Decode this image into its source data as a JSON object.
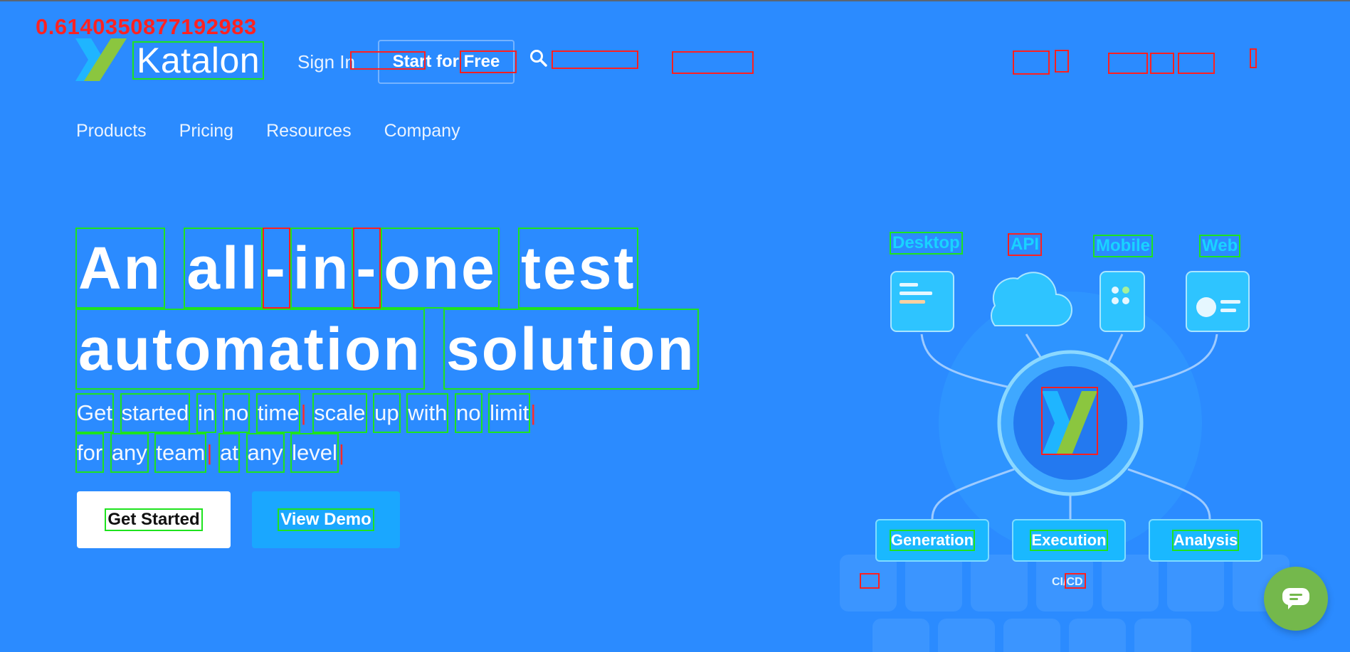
{
  "overlay": {
    "score": "0.6140350877192983"
  },
  "header": {
    "brand": "Katalon",
    "sign_in": "Sign In",
    "start_for_free": "Start for Free"
  },
  "nav": {
    "items": [
      "Products",
      "Pricing",
      "Resources",
      "Company"
    ]
  },
  "hero": {
    "title_line1": [
      "An",
      "all",
      "-",
      "in",
      "-",
      "one",
      "test"
    ],
    "title_line2": [
      "automation",
      "solution"
    ],
    "sub_line1": [
      "Get",
      "started",
      "in",
      "no",
      "time",
      "scale",
      "up",
      "with",
      "no",
      "limit"
    ],
    "sub_line2": [
      "for",
      "any",
      "team",
      "at",
      "any",
      "level"
    ],
    "get_started": "Get Started",
    "view_demo": "View Demo"
  },
  "diagram": {
    "platforms": [
      "Desktop",
      "API",
      "Mobile",
      "Web"
    ],
    "stages": [
      "Generation",
      "Execution",
      "Analysis"
    ],
    "cicd": "CI/CD"
  },
  "colors": {
    "background": "#2B8BFF",
    "accent": "#1AB8FF",
    "chat": "#74B84C"
  },
  "icons": {
    "search": "search-icon",
    "chat": "chat-icon",
    "logo": "katalon-logo-icon"
  }
}
